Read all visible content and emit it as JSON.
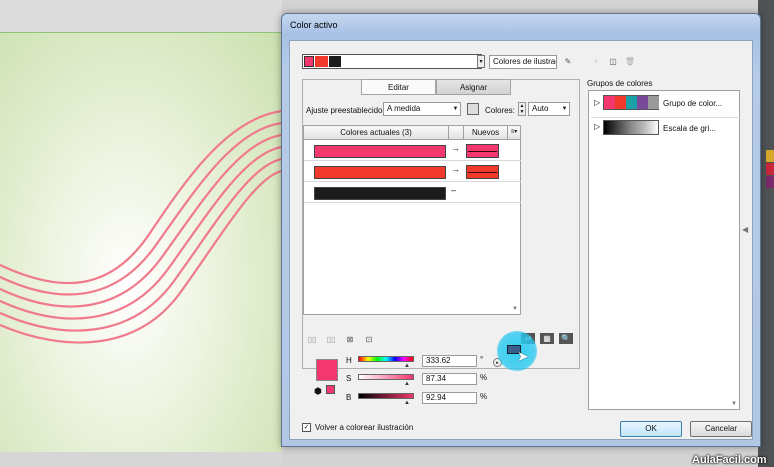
{
  "dialog": {
    "title": "Color activo",
    "library_dropdown": "Colores de ilustrac",
    "tabs": [
      "Editar",
      "Asignar"
    ],
    "preset_label": "Ajuste preestablecido:",
    "preset_value": "A medida",
    "colors_label": "Colores:",
    "colors_value": "Auto",
    "current_header": "Colores actuales (3)",
    "new_header": "Nuevos",
    "rows": [
      {
        "current": "#f2386e",
        "new": "#f2386e",
        "arrow": "→"
      },
      {
        "current": "#f23a2c",
        "new": "#f23a2c",
        "arrow": "→"
      },
      {
        "current": "#1c1c1c",
        "new": "",
        "arrow": "–"
      }
    ],
    "hsb": [
      {
        "label": "H",
        "value": "333.62",
        "unit": "°"
      },
      {
        "label": "S",
        "value": "87.34",
        "unit": "%"
      },
      {
        "label": "B",
        "value": "92.94",
        "unit": "%"
      }
    ],
    "recolor_label": "Volver a colorear ilustración",
    "ok": "OK",
    "cancel": "Cancelar"
  },
  "color_groups": {
    "title": "Grupos de colores",
    "items": [
      {
        "label": "Grupo de color...",
        "swatches": [
          "#f2386e",
          "#f23a2c",
          "#1aa0a8",
          "#7a4a9a",
          "#9a9a9a"
        ]
      },
      {
        "label": "Escala de gri..."
      }
    ]
  },
  "watermark": "AulaFacil.com",
  "colors": {
    "active_swatch": "#f2386e",
    "line_color": "#f07a8c",
    "accent_ring": "#28c8f0"
  }
}
